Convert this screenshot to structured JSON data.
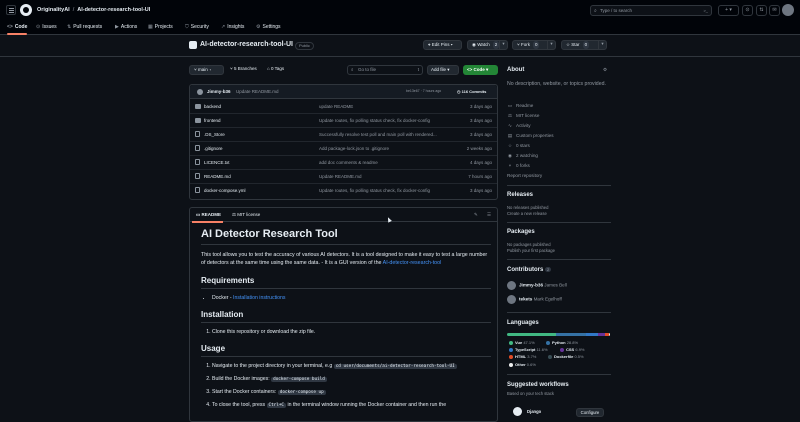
{
  "header": {
    "owner": "OriginalityAI",
    "separator": "/",
    "repo": "AI-detector-research-tool-UI",
    "search_placeholder": "Type / to search",
    "search_shortcut": ">_",
    "plus": "+ ▾"
  },
  "tabs": [
    {
      "icon": "<>",
      "label": "Code"
    },
    {
      "icon": "⊙",
      "label": "Issues"
    },
    {
      "icon": "⇅",
      "label": "Pull requests"
    },
    {
      "icon": "▶",
      "label": "Actions"
    },
    {
      "icon": "▦",
      "label": "Projects"
    },
    {
      "icon": "⛉",
      "label": "Security"
    },
    {
      "icon": "↗",
      "label": "Insights"
    },
    {
      "icon": "⚙",
      "label": "Settings"
    }
  ],
  "repo": {
    "name": "AI-detector-research-tool-UI",
    "visibility": "Public",
    "edit_pins": "Edit Pins ▾",
    "watch": "Watch",
    "watch_count": "2",
    "fork": "Fork",
    "fork_count": "0",
    "star": "Star",
    "star_count": "0"
  },
  "branchbar": {
    "branch": "main",
    "branches": "5 Branches",
    "tags": "0 Tags",
    "goto": "Go to file",
    "goto_key": "t",
    "add_file": "Add file ▾",
    "code": "Code ▾"
  },
  "commit": {
    "user": "Jimmy-b36",
    "message": "Update README.md",
    "hash_time": "be13e67 · 7 hours ago",
    "count": "116 Commits"
  },
  "files": [
    {
      "name": "backend",
      "type": "dir",
      "message": "update README",
      "date": "3 days ago"
    },
    {
      "name": "frontend",
      "type": "dir",
      "message": "Update routes, fix polling status check, fix docker-config",
      "date": "3 days ago"
    },
    {
      "name": ".DS_Store",
      "type": "file",
      "message": "Successfully resolve test poll and main poll with rendered...",
      "date": "3 days ago"
    },
    {
      "name": ".gitignore",
      "type": "file",
      "message": "Add package-lock.json to .gitignore",
      "date": "2 weeks ago"
    },
    {
      "name": "LICENCE.txt",
      "type": "file",
      "message": "add doc comments & readme",
      "date": "4 days ago"
    },
    {
      "name": "README.md",
      "type": "file",
      "message": "Update README.md",
      "date": "7 hours ago"
    },
    {
      "name": "docker-compose.yml",
      "type": "file",
      "message": "Update routes, fix polling status check, fix docker-config",
      "date": "3 days ago"
    }
  ],
  "readme": {
    "tab_readme": "README",
    "tab_license": "MIT license",
    "title": "AI Detector Research Tool",
    "intro": "This tool allows you to test the accuracy of various AI detectors. It is a tool designed to make it easy to test a large number of detectors at the same time using the same data. - It is a GUI version of the ",
    "intro_link": "AI-detector-research-tool",
    "h_requirements": "Requirements",
    "req_item": "Docker - ",
    "req_link": "Installation instructions",
    "h_installation": "Installation",
    "install_item": "Clone this repository or download the zip file.",
    "h_usage": "Usage",
    "usage_1": "Navigate to the project directory in your terminal, e.g ",
    "usage_1_code": "cd user/documents/ai-detector-research-tool-UI",
    "usage_2": "Build the Docker images: ",
    "usage_2_code": "docker-compose build",
    "usage_3": "Start the Docker containers: ",
    "usage_3_code": "docker-compose up",
    "usage_4": "To close the tool, press ",
    "usage_4_code": "Ctrl+C",
    "usage_4_rest": " in the terminal window running the Docker container and then run the"
  },
  "sidebar": {
    "about": "About",
    "description": "No description, website, or topics provided.",
    "items": [
      {
        "icon": "▭",
        "label": "Readme"
      },
      {
        "icon": "⚖",
        "label": "MIT license"
      },
      {
        "icon": "∿",
        "label": "Activity"
      },
      {
        "icon": "▤",
        "label": "Custom properties"
      },
      {
        "icon": "☆",
        "label": "0 stars"
      },
      {
        "icon": "◉",
        "label": "2 watching"
      },
      {
        "icon": "⑂",
        "label": "0 forks"
      }
    ],
    "report": "Report repository",
    "releases": "Releases",
    "no_releases": "No releases published",
    "create_release": "Create a new release",
    "packages": "Packages",
    "no_packages": "No packages published",
    "publish_package": "Publish your first package",
    "contributors": "Contributors",
    "contributors_count": "2",
    "contribs": [
      {
        "login": "Jimmy-b36",
        "name": "James Bell"
      },
      {
        "login": "tekets",
        "name": "Mark Egelhoff"
      }
    ],
    "languages": "Languages",
    "langs": [
      {
        "name": "Vue",
        "pct": "47.1%",
        "color": "#41b883",
        "share": 47.1
      },
      {
        "name": "Python",
        "pct": "28.8%",
        "color": "#3572a5",
        "share": 28.8
      },
      {
        "name": "TypeScript",
        "pct": "11.6%",
        "color": "#3178c6",
        "share": 11.6
      },
      {
        "name": "CSS",
        "pct": "6.9%",
        "color": "#663399",
        "share": 6.9
      },
      {
        "name": "HTML",
        "pct": "3.7%",
        "color": "#e34c26",
        "share": 3.7
      },
      {
        "name": "Dockerfile",
        "pct": "0.5%",
        "color": "#384d54",
        "share": 0.5
      },
      {
        "name": "Other",
        "pct": "0.6%",
        "color": "#ededed",
        "share": 0.6
      }
    ],
    "suggested": "Suggested workflows",
    "suggested_sub": "Based on your tech stack",
    "django": "Django",
    "configure": "Configure"
  }
}
